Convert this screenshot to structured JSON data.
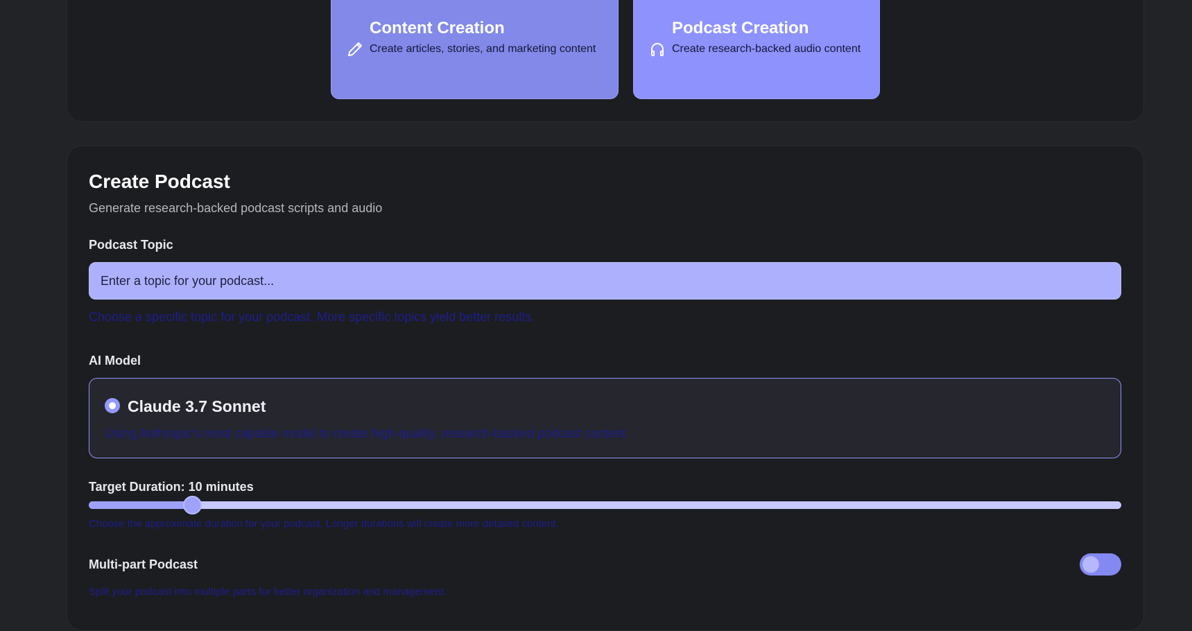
{
  "mode_selector": {
    "cards": [
      {
        "title": "Content Creation",
        "description": "Create articles, stories, and marketing content",
        "icon": "pencil-icon"
      },
      {
        "title": "Podcast Creation",
        "description": "Create research-backed audio content",
        "icon": "headphones-icon"
      }
    ]
  },
  "create_podcast": {
    "title": "Create Podcast",
    "subtitle": "Generate research-backed podcast scripts and audio",
    "topic": {
      "label": "Podcast Topic",
      "value": "",
      "placeholder": "Enter a topic for your podcast...",
      "hint": "Choose a specific topic for your podcast. More specific topics yield better results."
    },
    "model": {
      "label": "AI Model",
      "selected": true,
      "name": "Claude 3.7 Sonnet",
      "description": "Using Anthropic's most capable model to create high-quality, research-backed podcast content"
    },
    "duration": {
      "label": "Target Duration: 10 minutes",
      "value_fraction": 0.1,
      "hint": "Choose the approximate duration for your podcast. Longer durations will create more detailed content."
    },
    "multipart": {
      "label": "Multi-part Podcast",
      "enabled": false,
      "hint": "Split your podcast into multiple parts for better organization and management."
    }
  },
  "colors": {
    "background": "#222326",
    "panel": "#1c1d21",
    "accent": "#8e92fd",
    "hint_text": "#1e1e8c"
  }
}
